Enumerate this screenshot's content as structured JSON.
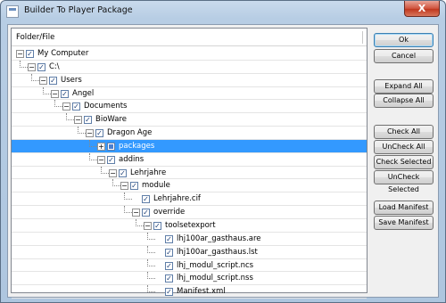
{
  "window": {
    "title": "Builder To Player Package",
    "close_label": "X"
  },
  "tree": {
    "header": "Folder/File",
    "rows": [
      {
        "label": "My Computer",
        "level": 0,
        "expander": "−",
        "checked": true,
        "partial": false,
        "selected": false
      },
      {
        "label": "C:\\",
        "level": 1,
        "expander": "−",
        "checked": true,
        "partial": false,
        "selected": false
      },
      {
        "label": "Users",
        "level": 2,
        "expander": "−",
        "checked": true,
        "partial": false,
        "selected": false
      },
      {
        "label": "Angel",
        "level": 3,
        "expander": "−",
        "checked": true,
        "partial": false,
        "selected": false
      },
      {
        "label": "Documents",
        "level": 4,
        "expander": "−",
        "checked": true,
        "partial": false,
        "selected": false
      },
      {
        "label": "BioWare",
        "level": 5,
        "expander": "−",
        "checked": true,
        "partial": false,
        "selected": false
      },
      {
        "label": "Dragon Age",
        "level": 6,
        "expander": "−",
        "checked": true,
        "partial": false,
        "selected": false
      },
      {
        "label": "packages",
        "level": 7,
        "expander": "+",
        "checked": false,
        "partial": true,
        "selected": true
      },
      {
        "label": "addins",
        "level": 7,
        "expander": "−",
        "checked": true,
        "partial": false,
        "selected": false
      },
      {
        "label": "Lehrjahre",
        "level": 8,
        "expander": "−",
        "checked": true,
        "partial": false,
        "selected": false
      },
      {
        "label": "module",
        "level": 9,
        "expander": "−",
        "checked": true,
        "partial": false,
        "selected": false
      },
      {
        "label": "Lehrjahre.cif",
        "level": 10,
        "expander": "",
        "checked": true,
        "partial": false,
        "selected": false
      },
      {
        "label": "override",
        "level": 10,
        "expander": "−",
        "checked": true,
        "partial": false,
        "selected": false
      },
      {
        "label": "toolsetexport",
        "level": 11,
        "expander": "−",
        "checked": true,
        "partial": false,
        "selected": false
      },
      {
        "label": "lhj100ar_gasthaus.are",
        "level": 12,
        "expander": "",
        "checked": true,
        "partial": false,
        "selected": false
      },
      {
        "label": "lhj100ar_gasthaus.lst",
        "level": 12,
        "expander": "",
        "checked": true,
        "partial": false,
        "selected": false
      },
      {
        "label": "lhj_modul_script.ncs",
        "level": 12,
        "expander": "",
        "checked": true,
        "partial": false,
        "selected": false
      },
      {
        "label": "lhj_modul_script.nss",
        "level": 12,
        "expander": "",
        "checked": true,
        "partial": false,
        "selected": false
      },
      {
        "label": "Manifest.xml",
        "level": 12,
        "expander": "",
        "checked": true,
        "partial": false,
        "selected": false
      }
    ]
  },
  "buttons": {
    "ok": "Ok",
    "cancel": "Cancel",
    "expand_all": "Expand All",
    "collapse_all": "Collapse All",
    "check_all": "Check All",
    "uncheck_all": "UnCheck All",
    "check_selected": "Check Selected",
    "uncheck_selected": "UnCheck Selected",
    "load_manifest": "Load Manifest",
    "save_manifest": "Save Manifest"
  }
}
